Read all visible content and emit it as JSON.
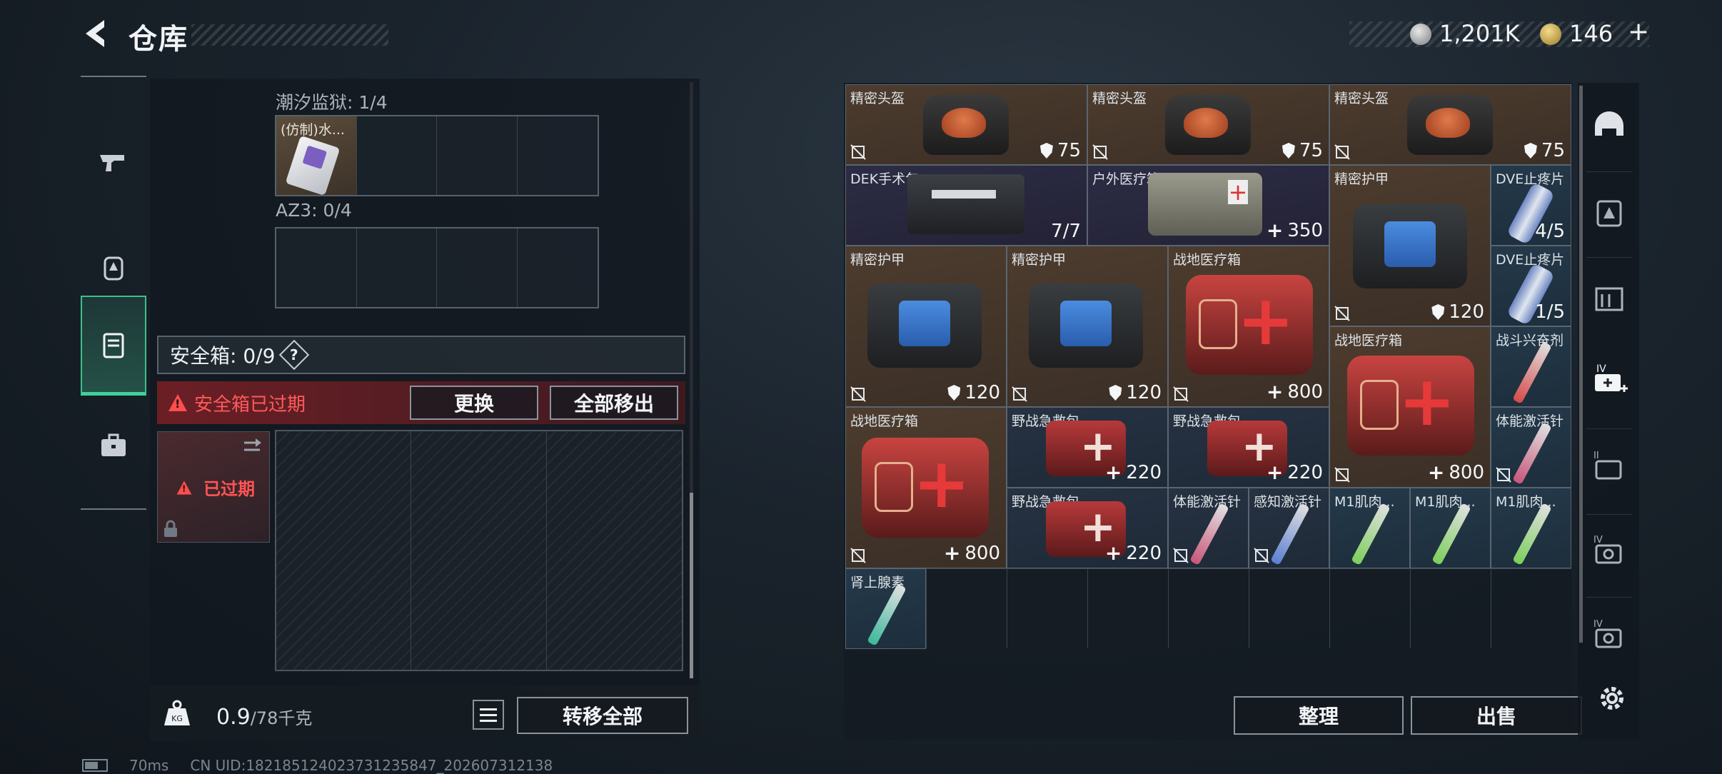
{
  "header": {
    "title": "仓库"
  },
  "currency": {
    "silver": "1,201K",
    "gold": "146"
  },
  "left": {
    "sections": [
      {
        "label": "潮汐监狱: 1/4",
        "item_name": "(仿制)水..."
      },
      {
        "label": "AZ3: 0/4"
      }
    ],
    "safe_box": {
      "label": "安全箱: 0/9",
      "help": "?"
    },
    "expired": {
      "text": "安全箱已过期",
      "replace_button": "更换",
      "move_all_button": "全部移出",
      "stamp": "已过期"
    },
    "weight": {
      "value": "0.9",
      "unit": "/78千克"
    },
    "transfer_all_button": "转移全部"
  },
  "status": {
    "ping": "70ms",
    "uid": "CN UID:1821851240237312358​47_202607312138"
  },
  "items": [
    {
      "name": "精密头盔",
      "value": "75"
    },
    {
      "name": "精密头盔",
      "value": "75"
    },
    {
      "name": "精密头盔",
      "value": "75"
    },
    {
      "name": "DEK手术包",
      "value": "7/7"
    },
    {
      "name": "户外医疗箱",
      "value": "350"
    },
    {
      "name": "精密护甲",
      "value": "120"
    },
    {
      "name": "DVE止疼片",
      "value": "4/5"
    },
    {
      "name": "DVE止疼片",
      "value": "1/5"
    },
    {
      "name": "精密护甲",
      "value": "120"
    },
    {
      "name": "精密护甲",
      "value": "120"
    },
    {
      "name": "战地医疗箱",
      "value": "800"
    },
    {
      "name": "战地医疗箱",
      "value": "800"
    },
    {
      "name": "战斗兴奋剂",
      "value": ""
    },
    {
      "name": "体能激活针",
      "value": ""
    },
    {
      "name": "战地医疗箱",
      "value": "800"
    },
    {
      "name": "野战急救包",
      "value": "220"
    },
    {
      "name": "野战急救包",
      "value": "220"
    },
    {
      "name": "野战急救包",
      "value": "220"
    },
    {
      "name": "体能激活针",
      "value": ""
    },
    {
      "name": "感知激活针",
      "value": ""
    },
    {
      "name": "M1肌肉...",
      "value": ""
    },
    {
      "name": "M1肌肉...",
      "value": ""
    },
    {
      "name": "M1肌肉...",
      "value": ""
    },
    {
      "name": "肾上腺素",
      "value": ""
    }
  ],
  "actions": {
    "organize": "整理",
    "sell": "出售"
  },
  "colors": {
    "accent_green": "#3fd19c",
    "warning_red": "#ff5a5a"
  }
}
